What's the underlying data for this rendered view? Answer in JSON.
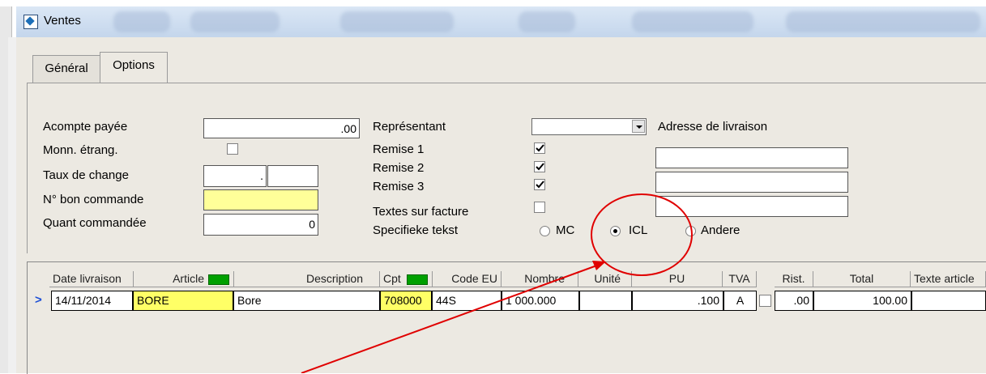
{
  "window": {
    "title": "Ventes"
  },
  "tabs": [
    {
      "label": "Général"
    },
    {
      "label": "Options"
    }
  ],
  "form": {
    "acompte_label": "Acompte payée",
    "acompte_value": ".00",
    "monn_label": "Monn. étrang.",
    "taux_label": "Taux de change",
    "taux_value_1": ".",
    "taux_value_2": "",
    "bon_label": "N° bon commande",
    "bon_value": "",
    "quant_label": "Quant commandée",
    "quant_value": "0",
    "representant_label": "Représentant",
    "representant_value": "",
    "remise1_label": "Remise 1",
    "remise2_label": "Remise 2",
    "remise3_label": "Remise 3",
    "textes_label": "Textes sur facture",
    "specifieke_label": "Specifieke tekst",
    "radio_mc": "MC",
    "radio_icl": "ICL",
    "radio_andere": "Andere",
    "selected_radio": "ICL",
    "adresse_label": "Adresse de livraison",
    "adresse_lines": [
      "",
      "",
      ""
    ],
    "checkbox_states": {
      "monn": false,
      "remise1": true,
      "remise2": true,
      "remise3": true,
      "textes": false
    }
  },
  "grid": {
    "headers": [
      "Date livraison",
      "Article",
      "Description",
      "Cpt",
      "Code EU",
      "Nombre",
      "Unité",
      "PU",
      "TVA",
      "Rist.",
      "Total",
      "Texte article"
    ],
    "row": {
      "date": "14/11/2014",
      "article": "BORE",
      "description": "Bore",
      "cpt": "708000",
      "code_eu": "44S",
      "nombre": "1 000.000",
      "unite": "",
      "pu": ".100",
      "tva": "A",
      "rist": ".00",
      "total": "100.00",
      "texte": ""
    }
  },
  "colors": {
    "annotation": "#e00000",
    "highlight_yellow": "#ffff99",
    "green_marker": "#00a000"
  }
}
